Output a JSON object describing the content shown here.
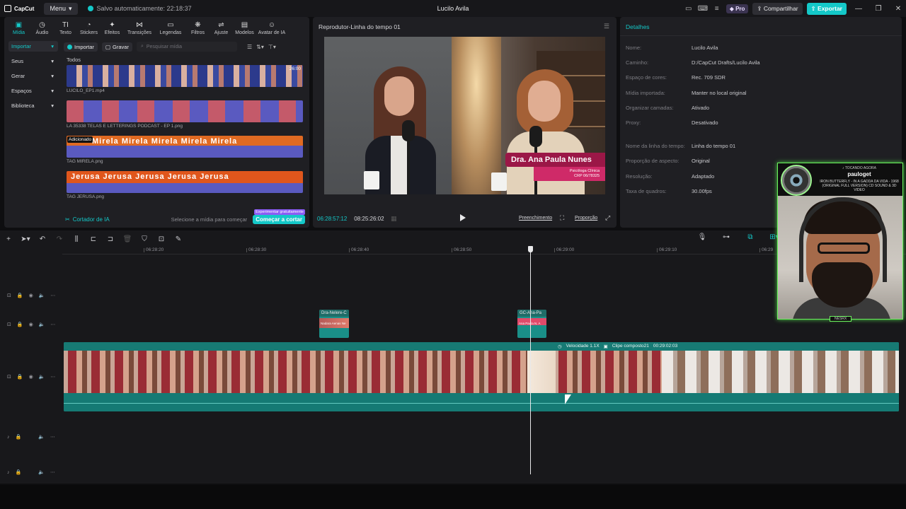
{
  "titlebar": {
    "app_name": "CapCut",
    "menu_label": "Menu",
    "autosave": "Salvo automaticamente: 22:18:37",
    "project_title": "Lucilo Avila",
    "pro_label": "Pro",
    "share_label": "Compartilhar",
    "export_label": "Exportar"
  },
  "toolbar": {
    "items": [
      {
        "label": "Mídia",
        "icon": "media-icon"
      },
      {
        "label": "Áudio",
        "icon": "audio-icon"
      },
      {
        "label": "Texto",
        "icon": "text-icon"
      },
      {
        "label": "Stickers",
        "icon": "sticker-icon"
      },
      {
        "label": "Efeitos",
        "icon": "effects-icon"
      },
      {
        "label": "Transições",
        "icon": "transitions-icon"
      },
      {
        "label": "Legendas",
        "icon": "captions-icon"
      },
      {
        "label": "Filtros",
        "icon": "filters-icon"
      },
      {
        "label": "Ajuste",
        "icon": "adjust-icon"
      },
      {
        "label": "Modelos",
        "icon": "templates-icon"
      },
      {
        "label": "Avatar de IA",
        "icon": "avatar-icon"
      }
    ]
  },
  "sidebar": {
    "items": [
      {
        "label": "Importar"
      },
      {
        "label": "Seus"
      },
      {
        "label": "Gerar"
      },
      {
        "label": "Espaços"
      },
      {
        "label": "Biblioteca"
      }
    ]
  },
  "media": {
    "import_label": "Importar",
    "record_label": "Gravar",
    "search_placeholder": "Pesquisar mídia",
    "section": "Todos",
    "clips": [
      {
        "name": "LUCILO_EP1.mp4",
        "duration": "26:00"
      },
      {
        "name": "LA 35338 TELAS E LETTERINGS PODCAST - EP 1.png"
      },
      {
        "name": "TAG MIRELA.png",
        "tag": "Adicionado",
        "overlay": "Mirela"
      },
      {
        "name": "TAG JERUSA.png",
        "overlay": "Jerusa"
      }
    ],
    "ai_title": "Cortador de IA",
    "ai_hint": "Selecione a mídia para começar",
    "ai_button": "Começar a cortar",
    "ai_badge": "Experimentar gratuitamente"
  },
  "player": {
    "title": "Reprodutor-Linha do tempo 01",
    "lower_third_name": "Dra. Ana Paula Nunes",
    "lower_third_sub1": "Psicóloga Clínica",
    "lower_third_sub2": "CRP 06/78325",
    "current_time": "06:28:57:12",
    "total_time": "08:25:26:02",
    "fill_label": "Preenchimento",
    "ratio_label": "Proporção"
  },
  "details": {
    "title": "Detalhes",
    "rows": [
      {
        "label": "Nome:",
        "value": "Lucilo Avila"
      },
      {
        "label": "Caminho:",
        "value": "D:/CapCut Drafts/Lucilo Avila"
      },
      {
        "label": "Espaço de cores:",
        "value": "Rec. 709 SDR"
      },
      {
        "label": "Mídia importada:",
        "value": "Manter no local original"
      },
      {
        "label": "Organizar camadas:",
        "value": "Ativado"
      },
      {
        "label": "Proxy:",
        "value": "Desativado"
      },
      {
        "label": "Nome da linha do tempo:",
        "value": "Linha do tempo 01"
      },
      {
        "label": "Proporção de aspecto:",
        "value": "Original"
      },
      {
        "label": "Resolução:",
        "value": "Adaptado"
      },
      {
        "label": "Taxa de quadros:",
        "value": "30.00fps"
      }
    ]
  },
  "timeline": {
    "ruler_ticks": [
      "06:28:20",
      "06:28:30",
      "06:28:40",
      "06:28:50",
      "06:29:00",
      "06:29:10",
      "06:29"
    ],
    "overlay_clip_1": "Dra-Nelere-C",
    "overlay_clip_1_sub": "Nadara Aenas Ne",
    "overlay_clip_2": "GC-Ana-Pa",
    "overlay_clip_2_sub": "Ana Paula N. A",
    "main_speed": "Velocidade 1.1X",
    "main_clip_name": "Clipe composto21",
    "main_clip_duration": "00:29:02:03"
  },
  "webcam": {
    "now_playing_label": "♪ TOCANDO AGORA",
    "artist": "pauloget",
    "song": "IRON BUTTERFLY - IN A GADDA DA VIDA - 1968 (ORIGINAL FULL VERSION) CD SOUND & 3D VIDEO",
    "tag": "NESRX"
  }
}
